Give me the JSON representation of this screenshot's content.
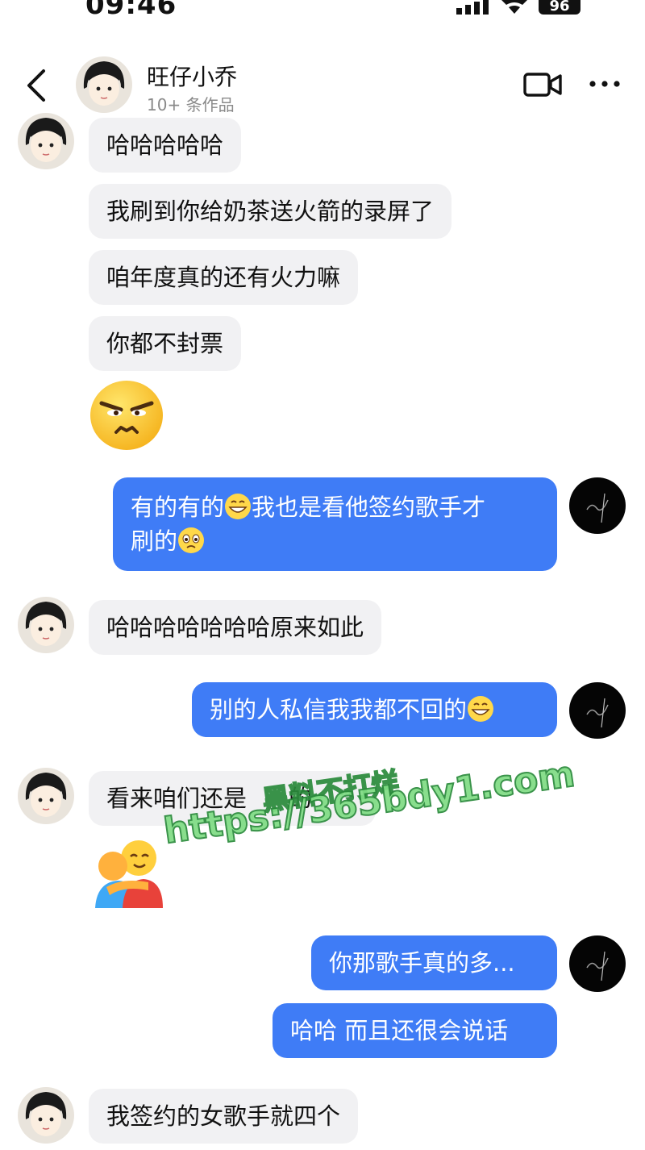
{
  "status_bar": {
    "time": "09:46",
    "battery": "96"
  },
  "header": {
    "name": "旺仔小乔",
    "subtitle": "10+ 条作品"
  },
  "messages": {
    "m1": "哈哈哈哈哈",
    "m2": "我刷到你给奶茶送火箭的录屏了",
    "m3": "咱年度真的还有火力嘛",
    "m4": "你都不封票",
    "m6a": "有的有的",
    "m6b": "我也是看他签约歌手才",
    "m6c": "刷的",
    "m7": "哈哈哈哈哈哈哈原来如此",
    "m8": "别的人私信我我都不回的",
    "m9": "看来咱们还是",
    "m9b": "的",
    "m11": "你那歌手真的多...",
    "m12": "哈哈 而且还很会说话",
    "m13": "我签约的女歌手就四个"
  },
  "watermark": {
    "line1": "黑料不打烊",
    "line2": "https://365bdy1.com"
  },
  "colors": {
    "outgoing": "#3f7cf6",
    "incoming": "#f1f1f3"
  }
}
